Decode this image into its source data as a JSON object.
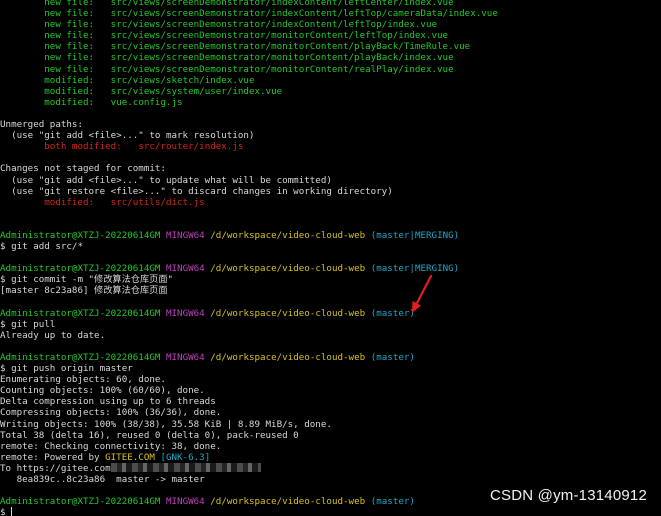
{
  "terminal": {
    "prompt": {
      "user_host": "Administrator@XTZJ-20220614GM",
      "shell": "MINGW64",
      "path": "/d/workspace/video-cloud-web"
    },
    "status_lines": [
      {
        "label": "new file:",
        "path": "src/views/screenDemonstrator/indexContent/leftCenter/index.vue"
      },
      {
        "label": "new file:",
        "path": "src/views/screenDemonstrator/indexContent/leftTop/cameraData/index.vue"
      },
      {
        "label": "new file:",
        "path": "src/views/screenDemonstrator/indexContent/leftTop/index.vue"
      },
      {
        "label": "new file:",
        "path": "src/views/screenDemonstrator/monitorContent/leftTop/index.vue"
      },
      {
        "label": "new file:",
        "path": "src/views/screenDemonstrator/monitorContent/playBack/TimeRule.vue"
      },
      {
        "label": "new file:",
        "path": "src/views/screenDemonstrator/monitorContent/playBack/index.vue"
      },
      {
        "label": "new file:",
        "path": "src/views/screenDemonstrator/monitorContent/realPlay/index.vue"
      },
      {
        "label": "modified:",
        "path": "src/views/sketch/index.vue"
      },
      {
        "label": "modified:",
        "path": "src/views/system/user/index.vue"
      },
      {
        "label": "modified:",
        "path": "vue.config.js"
      }
    ],
    "unmerged_header": "Unmerged paths:",
    "unmerged_hint": "  (use \"git add <file>...\" to mark resolution)",
    "unmerged_entry": {
      "label": "both modified:",
      "path": "src/router/index.js"
    },
    "not_staged_header": "Changes not staged for commit:",
    "not_staged_hint1": "  (use \"git add <file>...\" to update what will be committed)",
    "not_staged_hint2": "  (use \"git restore <file>...\" to discard changes in working directory)",
    "not_staged_entry": {
      "label": "modified:",
      "path": "src/utils/dict.js"
    },
    "blocks": [
      {
        "branch": "(master|MERGING)",
        "command": "$ git add src/*",
        "output": []
      },
      {
        "branch": "(master|MERGING)",
        "command": "$ git commit -m \"修改算法仓库页面\"",
        "output": [
          "[master 8c23a86] 修改算法仓库页面"
        ]
      },
      {
        "branch": "(master)",
        "command": "$ git pull",
        "output": [
          "Already up to date."
        ]
      },
      {
        "branch": "(master)",
        "command": "$ git push origin master",
        "output": [
          "Enumerating objects: 60, done.",
          "Counting objects: 100% (60/60), done.",
          "Delta compression using up to 6 threads",
          "Compressing objects: 100% (36/36), done.",
          "Writing objects: 100% (38/38), 35.58 KiB | 8.89 MiB/s, done.",
          "Total 38 (delta 16), reused 0 (delta 0), pack-reused 0",
          "remote: Checking connectivity: 38, done."
        ]
      }
    ],
    "powered_prefix": "remote: Powered by ",
    "powered_brand": "GITEE.COM",
    "powered_version": "[GNK-6.3]",
    "to_line": "To https://gitee.com",
    "push_result": "   8ea839c..8c23a86  master -> master",
    "final_branch": "(master)",
    "final_prompt": "$ "
  },
  "watermark": "CSDN @ym-13140912",
  "colors": {
    "background": "#000000",
    "green": "#23c92a",
    "red": "#d3261e",
    "magenta": "#be3fbe",
    "yellow": "#d6c11f",
    "cyan": "#21a7c7",
    "text": "#d8d8d8",
    "annotation_arrow": "#e0201c"
  }
}
